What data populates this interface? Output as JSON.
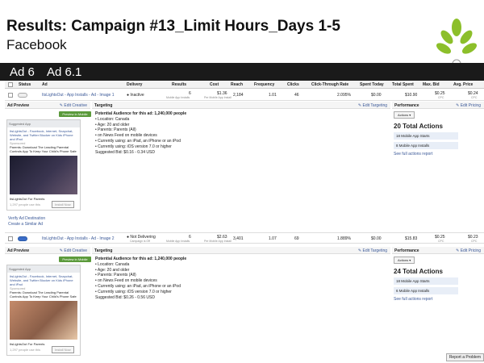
{
  "slide": {
    "title": "Results: Campaign #13_Limit Hours_Days 1-5",
    "subtitle": "Facebook",
    "ad_labels": [
      "Ad 6",
      "Ad 6.1"
    ],
    "logo": "leaf-icon"
  },
  "table": {
    "columns": [
      "Status",
      "Ad",
      "Delivery",
      "Results",
      "Cost",
      "Reach",
      "Frequency",
      "Clicks",
      "Click-Through Rate",
      "Spent Today",
      "Total Spent",
      "Max. Bid",
      "Avg. Price"
    ],
    "rows": [
      {
        "ad": "ItsLightsOut - App Installs - Ad - Image 1",
        "delivery": "Inactive",
        "results": "6",
        "results_sub": "Mobile App Installs",
        "cost": "$1.36",
        "cost_sub": "Per Mobile App Install",
        "reach": "2,184",
        "frequency": "1.01",
        "clicks": "46",
        "ctr": "2.095%",
        "spent_today": "$0.00",
        "total_spent": "$10.90",
        "max_bid": "$0.25",
        "max_bid_sub": "CPC",
        "avg_price": "$0.24",
        "avg_price_sub": "CPC"
      },
      {
        "ad": "ItsLightsOut - App Installs - Ad - Image 2",
        "delivery": "Not Delivering",
        "delivery_sub": "Campaign is Off",
        "results": "6",
        "results_sub": "Mobile App Installs",
        "cost": "$2.63",
        "cost_sub": "Per Mobile App Install",
        "reach": "3,401",
        "frequency": "1.07",
        "clicks": "69",
        "ctr": "1.889%",
        "spent_today": "$0.00",
        "total_spent": "$15.83",
        "max_bid": "$0.25",
        "max_bid_sub": "CPC",
        "avg_price": "$0.23",
        "avg_price_sub": "CPC"
      }
    ]
  },
  "details": [
    {
      "ad_preview": "Ad Preview",
      "edit_creative": "Edit Creative",
      "preview_btn": "Preview in Mobile Feed",
      "card": {
        "band": "Suggested App",
        "app_title": "ItsLightsOut - Facebook, Internet, Snapchat, Website, and Twitter Blocker on Kids iPhone and iPad",
        "sponsored": "Sponsored",
        "body": "Parents: Download The Leading Parental Controls App To Keep Your Child's Phone Safe",
        "footer_name": "ItsLightsOut For Parents",
        "footer_sub": "1,297 people use this",
        "install": "Install Now"
      },
      "targeting": "Targeting",
      "edit_targeting": "Edit Targeting",
      "audience": "Potential Audience for this ad: 1,240,000 people",
      "bullets": [
        "Location: Canada",
        "Age: 20 and older",
        "Parents: Parents (All)",
        "on News Feed on mobile devices",
        "Currently using: an iPad, an iPhone or an iPod",
        "Currently using: iOS version 7.0 or higher"
      ],
      "suggested_bid": "Suggested Bid: $0.16 - 0.34 USD",
      "performance": "Performance",
      "edit_pricing": "Edit Pricing",
      "actions": "Actions",
      "total_actions": "20 Total Actions",
      "metrics": [
        "18 Mobile App Starts",
        "8 Mobile App Installs"
      ],
      "see_all": "See full actions report",
      "links": [
        "Verify Ad Destination",
        "Create a Similar Ad"
      ]
    },
    {
      "ad_preview": "Ad Preview",
      "edit_creative": "Edit Creative",
      "preview_btn": "Preview in Mobile Feed",
      "card": {
        "band": "Suggested App",
        "app_title": "ItsLightsOut - Facebook, Internet, Snapchat, Website, and Twitter Blocker on Kids iPhone and iPad",
        "sponsored": "Sponsored",
        "body": "Parents: Download The Leading Parental Controls App To Keep Your Child's Phone Safe",
        "footer_name": "ItsLightsOut For Parents",
        "footer_sub": "1,297 people use this",
        "install": "Install Now"
      },
      "targeting": "Targeting",
      "edit_targeting": "Edit Targeting",
      "audience": "Potential Audience for this ad: 1,240,000 people",
      "bullets": [
        "Location: Canada",
        "Age: 20 and older",
        "Parents: Parents (All)",
        "on News Feed on mobile devices",
        "Currently using: an iPad, an iPhone or an iPod",
        "Currently using: iOS version 7.0 or higher"
      ],
      "suggested_bid": "Suggested Bid: $0.26 - 0.56 USD",
      "performance": "Performance",
      "edit_pricing": "Edit Pricing",
      "actions": "Actions",
      "total_actions": "24 Total Actions",
      "metrics": [
        "18 Mobile App Starts",
        "6 Mobile App Installs"
      ],
      "see_all": "See full actions report"
    }
  ],
  "report_problem": "Report a Problem"
}
